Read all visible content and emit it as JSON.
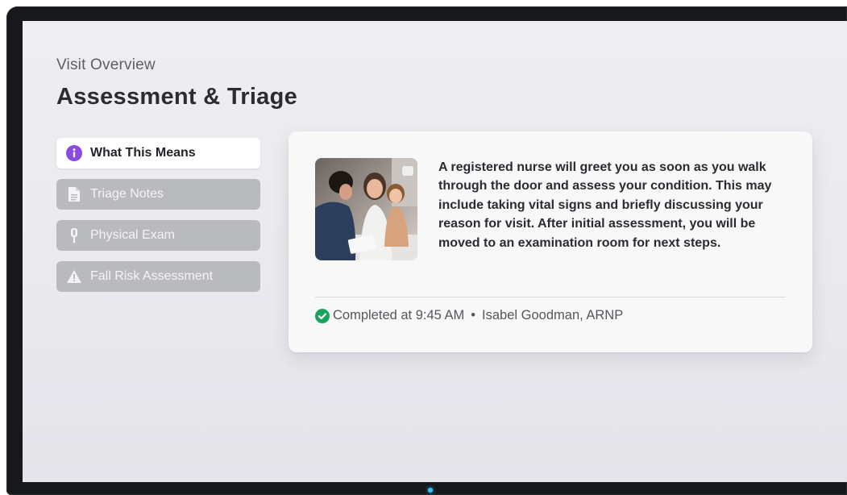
{
  "header": {
    "subtitle": "Visit Overview",
    "title": "Assessment & Triage"
  },
  "nav": {
    "items": [
      {
        "label": "What This Means",
        "icon": "info-icon",
        "active": true
      },
      {
        "label": "Triage Notes",
        "icon": "document-icon",
        "active": false
      },
      {
        "label": "Physical Exam",
        "icon": "thermometer-icon",
        "active": false
      },
      {
        "label": "Fall Risk Assessment",
        "icon": "warning-icon",
        "active": false
      }
    ]
  },
  "card": {
    "description": "A registered nurse will greet you as soon as you walk through the door and assess your condition. This may include taking vital signs and briefly discussing your reason for visit. After initial assessment, you will be moved to an examination room for next steps.",
    "status": {
      "completed_text": "Completed at 9:45 AM",
      "separator": "•",
      "provider": "Isabel Goodman, ARNP",
      "icon": "check-circle-icon"
    }
  },
  "colors": {
    "accent_purple": "#8b4be0",
    "success_green": "#1aa35a",
    "nav_inactive": "#b9babe",
    "led": "#35c3f0"
  }
}
